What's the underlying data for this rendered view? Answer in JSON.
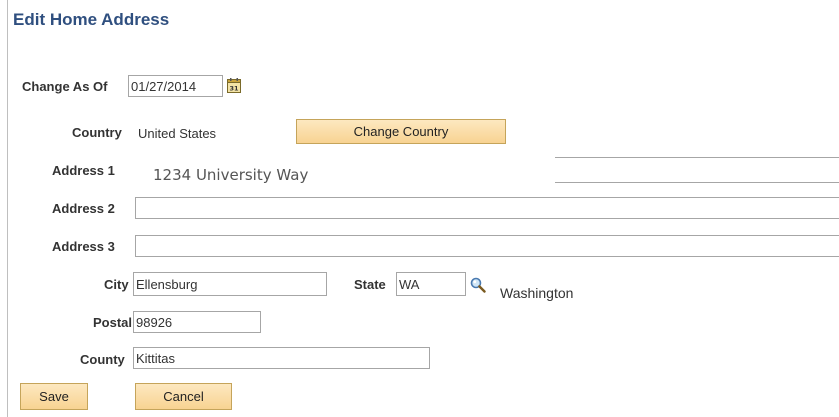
{
  "page": {
    "title": "Edit Home Address"
  },
  "form": {
    "change_as_of": {
      "label": "Change As Of",
      "value": "01/27/2014",
      "icon": "calendar-icon"
    },
    "country": {
      "label": "Country",
      "value": "United States",
      "change_button": "Change Country"
    },
    "address1": {
      "label": "Address 1",
      "value": "1234 University Way"
    },
    "address2": {
      "label": "Address 2",
      "value": ""
    },
    "address3": {
      "label": "Address 3",
      "value": ""
    },
    "city": {
      "label": "City",
      "value": "Ellensburg"
    },
    "state": {
      "label": "State",
      "value": "WA",
      "description": "Washington",
      "icon": "search-icon"
    },
    "postal": {
      "label": "Postal",
      "value": "98926"
    },
    "county": {
      "label": "County",
      "value": "Kittitas"
    }
  },
  "actions": {
    "save_label": "Save",
    "cancel_label": "Cancel"
  },
  "colors": {
    "title": "#2f4f7f",
    "button_fill": "#f8d392",
    "button_border": "#c5a45a",
    "input_border": "#a6a6a6"
  }
}
